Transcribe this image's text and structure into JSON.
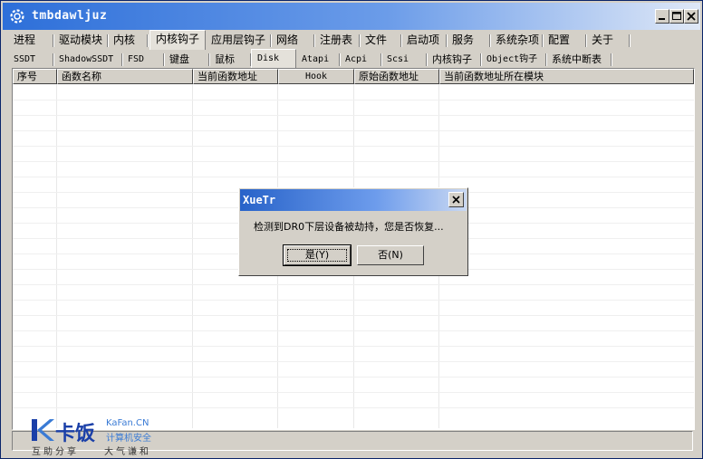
{
  "window": {
    "title": "tmbdawljuz"
  },
  "tabs_main": [
    {
      "label": "进程"
    },
    {
      "label": "驱动模块"
    },
    {
      "label": "内核"
    },
    {
      "label": "内核钩子"
    },
    {
      "label": "应用层钩子"
    },
    {
      "label": "网络"
    },
    {
      "label": "注册表"
    },
    {
      "label": "文件"
    },
    {
      "label": "启动项"
    },
    {
      "label": "服务"
    },
    {
      "label": "系统杂项"
    },
    {
      "label": "配置"
    },
    {
      "label": "关于"
    }
  ],
  "tabs_sub": [
    {
      "label": "SSDT"
    },
    {
      "label": "ShadowSSDT"
    },
    {
      "label": "FSD"
    },
    {
      "label": "键盘"
    },
    {
      "label": "鼠标"
    },
    {
      "label": "Disk"
    },
    {
      "label": "Atapi"
    },
    {
      "label": "Acpi"
    },
    {
      "label": "Scsi"
    },
    {
      "label": "内核钩子"
    },
    {
      "label": "Object钩子"
    },
    {
      "label": "系统中断表"
    }
  ],
  "columns": [
    {
      "label": "序号"
    },
    {
      "label": "函数名称"
    },
    {
      "label": "当前函数地址"
    },
    {
      "label": "Hook"
    },
    {
      "label": "原始函数地址"
    },
    {
      "label": "当前函数地址所在模块"
    }
  ],
  "dialog": {
    "title": "XueTr",
    "message": "检测到DR0下层设备被劫持，您是否恢复...",
    "yes_label": "是(Y)",
    "no_label": "否(N)"
  },
  "watermark": {
    "brand": "卡饭",
    "site": "KaFan.CN",
    "subtitle": "计算机安全",
    "slogan_left": "互助分享",
    "slogan_right": "大气谦和"
  },
  "colors": {
    "titlebar": "#2d6fd9",
    "dialog_title": "#2863c9",
    "face": "#d4d0c8"
  }
}
